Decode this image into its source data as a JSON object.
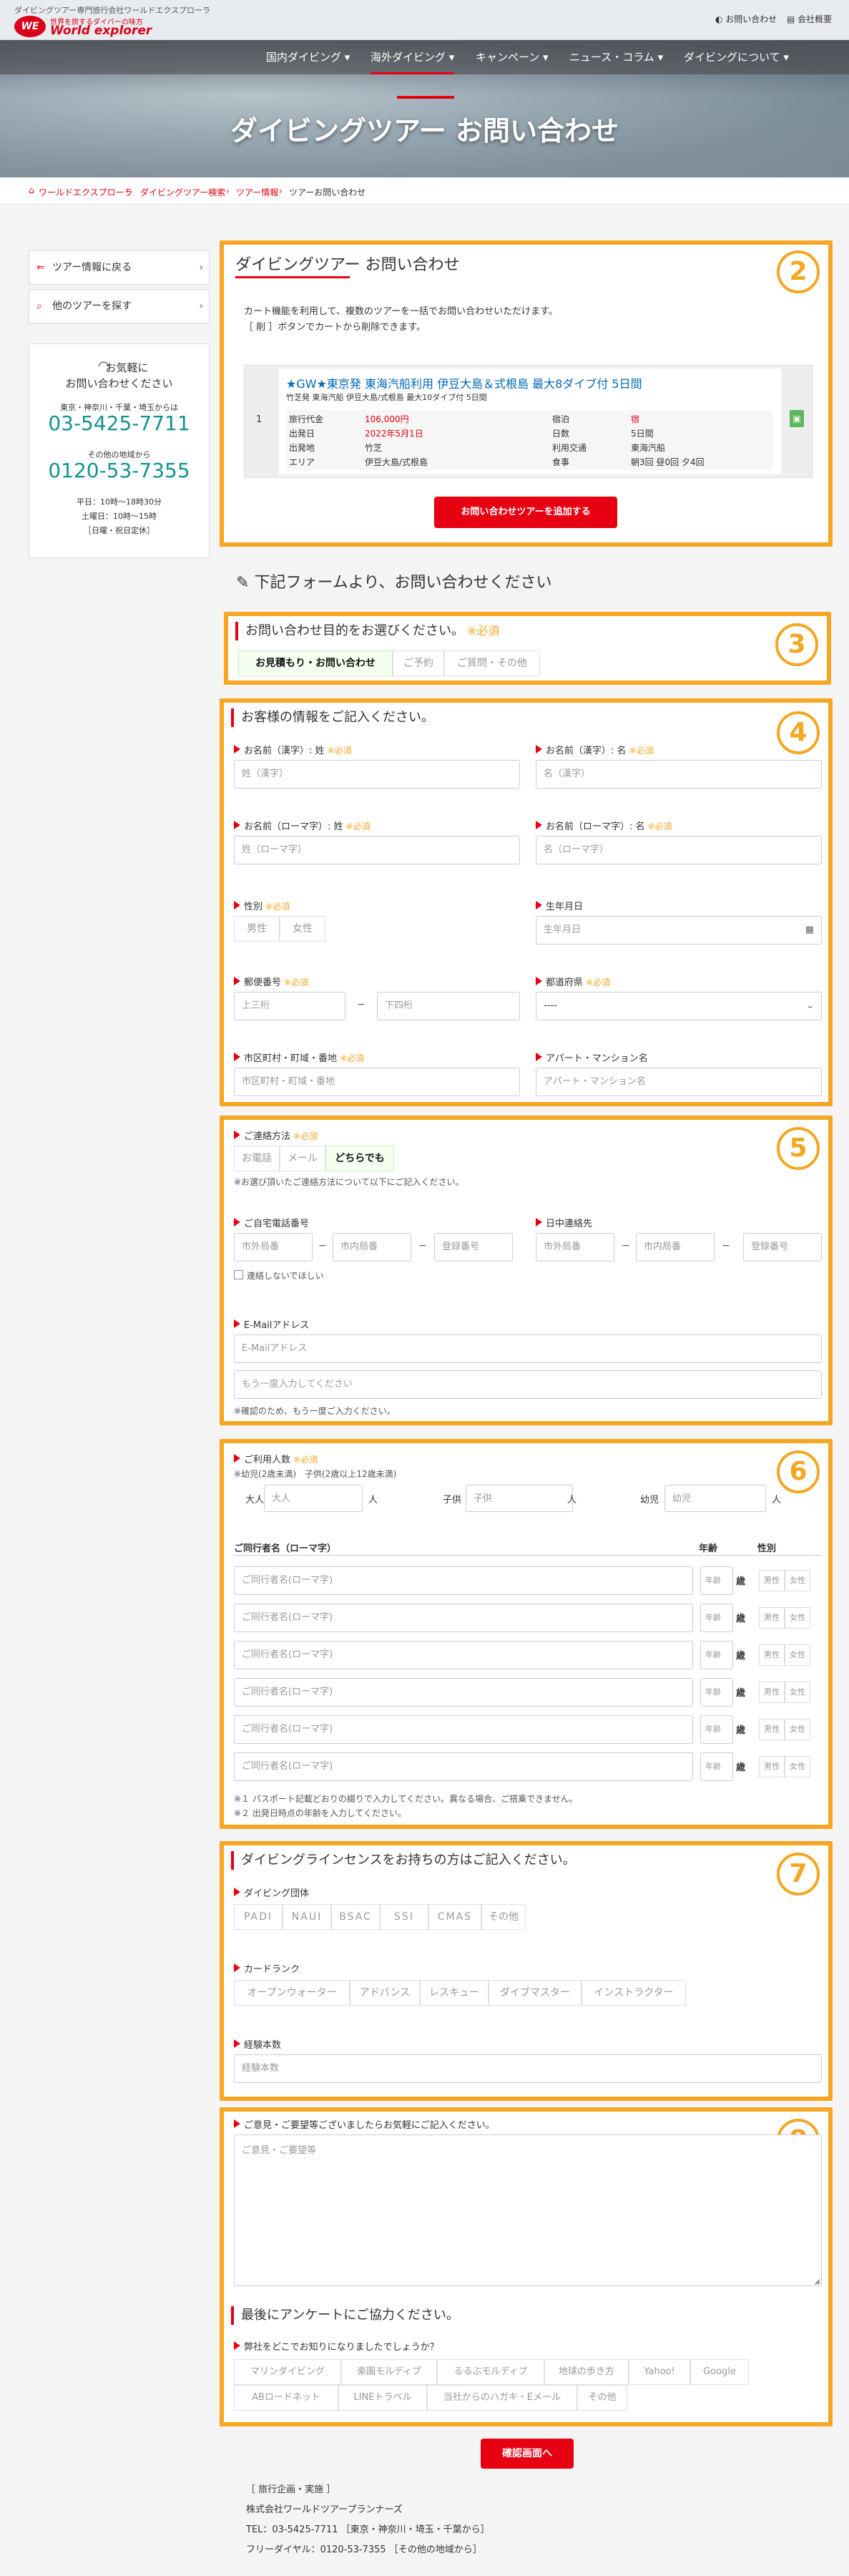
{
  "header": {
    "tagline": "ダイビングツアー専門旅行会社ワールドエクスプローラ",
    "logo_sub": "世界を旅するダイバーの味方",
    "logo_main": "World explorer",
    "contact_link": "お問い合わせ",
    "company_link": "会社概要"
  },
  "nav": [
    "国内ダイビング ▾",
    "海外ダイビング ▾",
    "キャンペーン ▾",
    "ニュース・コラム ▾",
    "ダイビングについて ▾"
  ],
  "hero_title": "ダイビングツアー お問い合わせ",
  "breadcrumb": [
    "ワールドエクスプローラ",
    "ダイビングツアー検索",
    "ツアー情報",
    "ツアーお問い合わせ"
  ],
  "sidebar": {
    "back_button": "ツアー情報に戻る",
    "other_button": "他のツアーを探す",
    "contact_head1": "お気軽に",
    "contact_head2": "お問い合わせください",
    "tokyo_area": "東京・神奈川・千葉・埼玉からは",
    "tokyo_tel": "03-5425-7711",
    "other_area": "その他の地域から",
    "free_tel": "0120-53-7355",
    "hours1": "平日：10時〜18時30分",
    "hours2": "土曜日：10時〜15時",
    "hours3": "［日曜・祝日定休］"
  },
  "cart": {
    "number": "2",
    "title": "ダイビングツアー お問い合わせ",
    "desc1": "カート機能を利用して、複数のツアーを一括でお問い合わせいただけます。",
    "desc2": "［ 削 ］ボタンでカートから削除できます。",
    "row_no": "1",
    "tour_title": "★GW★東京発 東海汽船利用 伊豆大島＆式根島 最大8ダイブ付 5日間",
    "tour_sub": "竹芝発 東海汽船 伊豆大島/式根島 最大10ダイブ付 5日間",
    "labels": [
      "旅行代金",
      "出発日",
      "出発地",
      "エリア"
    ],
    "values": [
      "106,000円",
      "2022年5月1日",
      "竹芝",
      "伊豆大島/式根島"
    ],
    "labels2": [
      "宿泊",
      "日数",
      "利用交通",
      "食事"
    ],
    "values2": [
      "宿",
      "5日間",
      "東海汽船",
      "朝3回 昼0回 夕4回"
    ],
    "add_button": "お問い合わせツアーを追加する"
  },
  "form_heading": "下記フォームより、お問い合わせください",
  "purpose": {
    "number": "3",
    "title": "お問い合わせ目的をお選びください。",
    "required": "※必須",
    "options": [
      "お見積もり・お問い合わせ",
      "ご予約",
      "ご質問・その他"
    ]
  },
  "customer": {
    "number": "4",
    "title": "お客様の情報をご記入ください。",
    "required": "※必須",
    "last_kanji_label": "お名前（漢字）: 姓",
    "last_kanji_ph": "姓（漢字）",
    "first_kanji_label": "お名前（漢字）: 名",
    "first_kanji_ph": "名（漢字）",
    "last_roma_label": "お名前（ローマ字）: 姓",
    "last_roma_ph": "姓（ローマ字）",
    "first_roma_label": "お名前（ローマ字）: 名",
    "first_roma_ph": "名（ローマ字）",
    "gender_label": "性別",
    "gender_options": [
      "男性",
      "女性"
    ],
    "birth_label": "生年月日",
    "birth_ph": "生年月日",
    "zip_label": "郵便番号",
    "zip1_ph": "上三桁",
    "zip2_ph": "下四桁",
    "pref_label": "都道府県",
    "pref_value": "----",
    "city_label": "市区町村・町域・番地",
    "city_ph": "市区町村・町域・番地",
    "apt_label": "アパート・マンション名",
    "apt_ph": "アパート・マンション名"
  },
  "contact": {
    "number": "5",
    "method_label": "ご連絡方法",
    "required": "※必須",
    "options": [
      "お電話",
      "メール",
      "どちらでも"
    ],
    "note": "※お選び頂いたご連絡方法について以下にご記入ください。",
    "home_tel_label": "ご自宅電話番号",
    "day_tel_label": "日中連絡先",
    "tel_ph": [
      "市外局番",
      "市内局番",
      "登録番号"
    ],
    "no_contact": "連絡しないでほしい",
    "email_label": "E-Mailアドレス",
    "email_ph": "E-Mailアドレス",
    "email2_ph": "もう一度入力してください",
    "email_note": "※確認のため、もう一度ご入力ください。"
  },
  "people": {
    "number": "6",
    "label": "ご利用人数",
    "required": "※必須",
    "note": "※幼児(2歳未満)　子供(2歳以上12歳未満)",
    "adult": "大人",
    "adult_ph": "大人",
    "child": "子供",
    "child_ph": "子供",
    "infant": "幼児",
    "infant_ph": "幼児",
    "unit": "人",
    "col_name": "ご同行者名（ローマ字）",
    "col_age": "年齢",
    "col_gender": "性別",
    "companion_ph": "ご同行者名(ローマ字)",
    "age_ph": "年齢",
    "age_unit": "歳",
    "gender_opts": [
      "男性",
      "女性"
    ],
    "note1": "※１ パスポート記載どおりの綴りで入力してください。異なる場合、ご搭乗できません。",
    "note2": "※２ 出発日時点の年齢を入力してください。"
  },
  "license": {
    "number": "7",
    "title": "ダイビングラインセンスをお持ちの方はご記入ください。",
    "org_label": "ダイビング団体",
    "orgs": [
      "PADI",
      "NAUI",
      "BSAC",
      "SSI",
      "CMAS",
      "その他"
    ],
    "rank_label": "カードランク",
    "ranks": [
      "オープンウォーター",
      "アドバンス",
      "レスキュー",
      "ダイブマスター",
      "インストラクター"
    ],
    "dives_label": "経験本数",
    "dives_ph": "経験本数"
  },
  "opinion": {
    "number": "8",
    "label": "ご意見・ご要望等ございましたらお気軽にご記入ください。",
    "ph": "ご意見・ご要望等",
    "survey_title": "最後にアンケートにご協力ください。",
    "survey_q": "弊社をどこでお知りになりましたでしょうか？",
    "row1": [
      "マリンダイビング",
      "楽園モルディブ",
      "るるぶモルディブ",
      "地球の歩き方",
      "Yahoo!",
      "Google"
    ],
    "row2": [
      "ABロードネット",
      "LINEトラベル",
      "当社からのハガキ・Eメール",
      "その他"
    ]
  },
  "confirm_button": "確認画面へ",
  "footer": {
    "l1": "［ 旅行企画・実施 ］",
    "l2": "株式会社ワールドツアープランナーズ",
    "l3": "TEL：03-5425-7711 ［東京・神奈川・埼玉・千葉から］",
    "l4": "フリーダイヤル：0120-53-7355 ［その他の地域から］"
  },
  "colors": {
    "accent": "#e60012",
    "highlight": "#f5a623",
    "link": "#0068b7",
    "teal": "#12948e"
  }
}
